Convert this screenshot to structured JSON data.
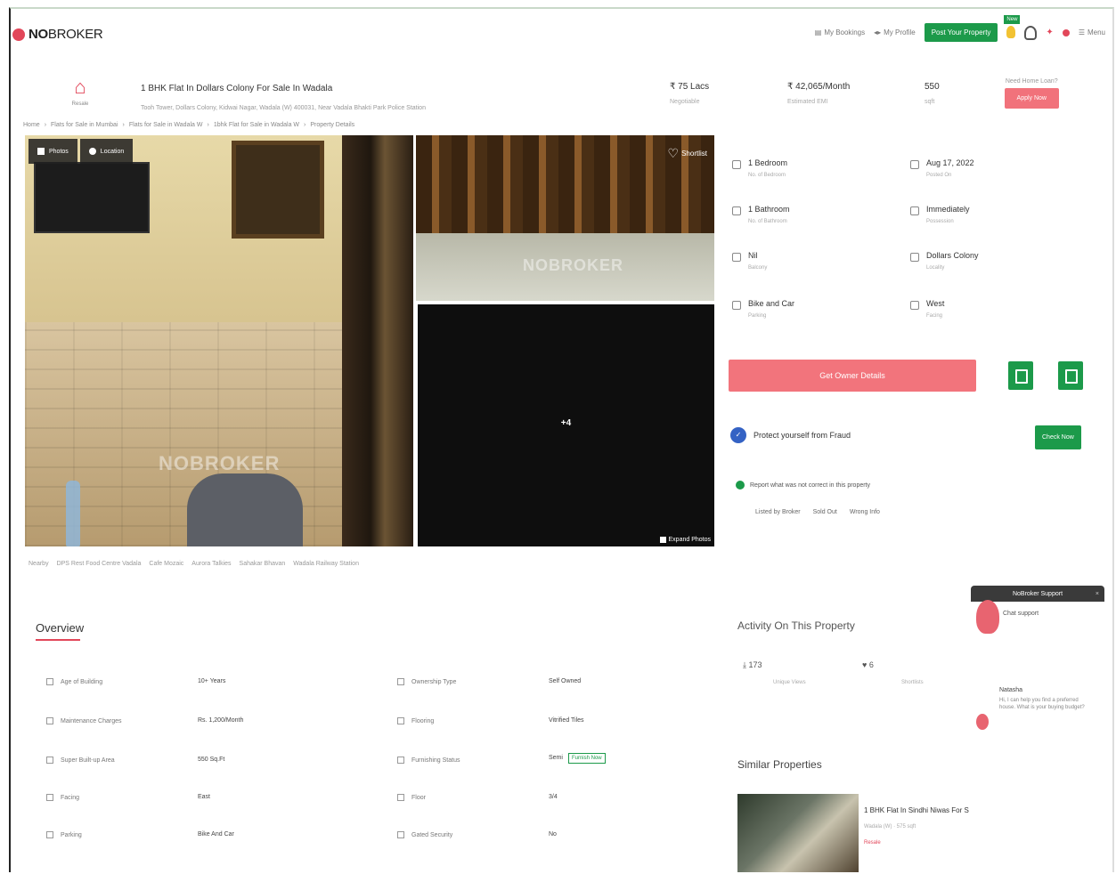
{
  "brand": {
    "name_bold": "NO",
    "name_light": "BROKER"
  },
  "nav": {
    "items": [
      "My Bookings",
      "My Profile"
    ],
    "post_property": "Post Your Property",
    "new_tag": "New",
    "menu": "Menu"
  },
  "property": {
    "icon_caption": "Resale",
    "title": "1 BHK Flat In Dollars Colony For Sale In Wadala",
    "subtitle": "Tooh Tower, Dollars Colony, Kidwai Nagar, Wadala (W) 400031, Near Vadala Bhakti Park Police Station",
    "price": "₹ 75 Lacs",
    "price_caption": "Negotiable",
    "emi": "₹ 42,065/Month",
    "emi_caption": "Estimated EMI",
    "area": "550",
    "area_caption": "sqft",
    "contact_caption": "Need Home Loan?",
    "contact_button": "Apply Now"
  },
  "breadcrumb": [
    "Home",
    "Flats for Sale in Mumbai",
    "Flats for Sale in Wadala W",
    "1bhk Flat for Sale in Wadala W",
    "Property Details"
  ],
  "gallery": {
    "photos_label": "Photos",
    "location_label": "Location",
    "shortlist_label": "Shortlist",
    "watermark": "NOBROKER",
    "more_count": "+4",
    "expand_label": "Expand Photos"
  },
  "nearby": [
    "Nearby",
    "DPS Rest Food Centre Vadala",
    "Cafe Mozaic",
    "Aurora Talkies",
    "Sahakar Bhavan",
    "Wadala Railway Station"
  ],
  "details": [
    {
      "value": "1 Bedroom",
      "caption": "No. of Bedroom"
    },
    {
      "value": "Aug 17, 2022",
      "caption": "Posted On"
    },
    {
      "value": "1 Bathroom",
      "caption": "No. of Bathroom"
    },
    {
      "value": "Immediately",
      "caption": "Possession"
    },
    {
      "value": "Nil",
      "caption": "Balcony"
    },
    {
      "value": "Dollars Colony",
      "caption": "Locality"
    },
    {
      "value": "Bike and Car",
      "caption": "Parking"
    },
    {
      "value": "West",
      "caption": "Facing"
    }
  ],
  "owner_button": "Get Owner Details",
  "fraud": {
    "title": "Protect yourself from Fraud",
    "check_button": "Check Now"
  },
  "report": {
    "text": "Report what was not correct in this property",
    "options": [
      "Listed by Broker",
      "Sold Out",
      "Wrong Info"
    ]
  },
  "overview": {
    "title": "Overview",
    "left": [
      {
        "label": "Age of Building",
        "value": "10+ Years"
      },
      {
        "label": "Maintenance Charges",
        "value": "Rs. 1,200/Month"
      },
      {
        "label": "Super Built-up Area",
        "value": "550 Sq.Ft"
      },
      {
        "label": "Facing",
        "value": "East"
      },
      {
        "label": "Parking",
        "value": "Bike And Car"
      }
    ],
    "right": [
      {
        "label": "Ownership Type",
        "value": "Self Owned"
      },
      {
        "label": "Flooring",
        "value": "Vitrified Tiles"
      },
      {
        "label": "Furnishing Status",
        "value": "Semi",
        "link": "Furnish Now"
      },
      {
        "label": "Floor",
        "value": "3/4"
      },
      {
        "label": "Gated Security",
        "value": "No"
      }
    ]
  },
  "activity": {
    "title": "Activity On This Property",
    "views": "173",
    "views_caption": "Unique Views",
    "shortlists": "6",
    "shortlists_caption": "Shortlists"
  },
  "similar": {
    "title": "Similar Properties",
    "item_title": "1 BHK Flat In Sindhi Niwas For S",
    "item_sub": "Wadala (W) · 575 sqft",
    "item_tag": "Resale"
  },
  "chat": {
    "header": "NoBroker Support",
    "support": "Chat support",
    "name": "Natasha",
    "message": "Hi, I can help you find a preferred house. What is your buying budget?"
  },
  "colors": {
    "brand_red": "#e2475a",
    "brand_green": "#1c9a4a",
    "owner_button": "#f2747c"
  }
}
